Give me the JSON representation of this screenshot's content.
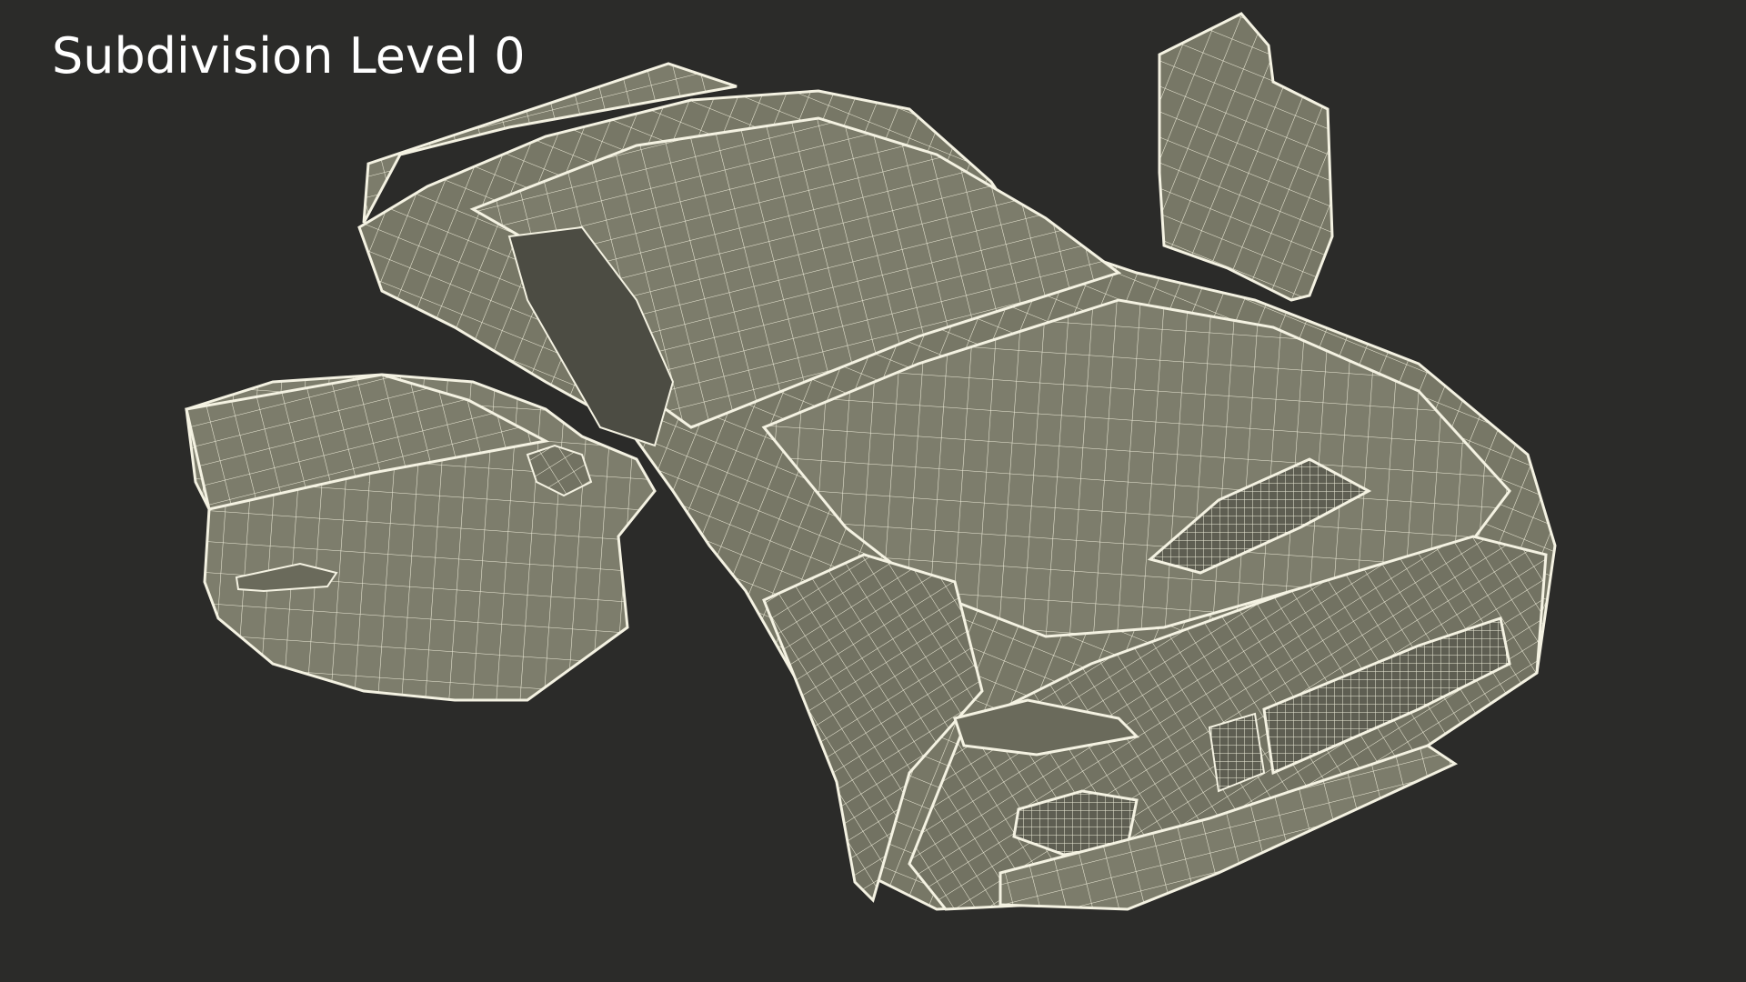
{
  "caption": "Subdivision Level 0",
  "colors": {
    "background": "#2b2b29",
    "surface": "#7c7c6b",
    "surface_dark": "#6b6b5c",
    "wire": "#f4f2e2",
    "caption": "#ffffff"
  },
  "subject": {
    "type": "wireframe-car-render",
    "doors": "both-open"
  }
}
